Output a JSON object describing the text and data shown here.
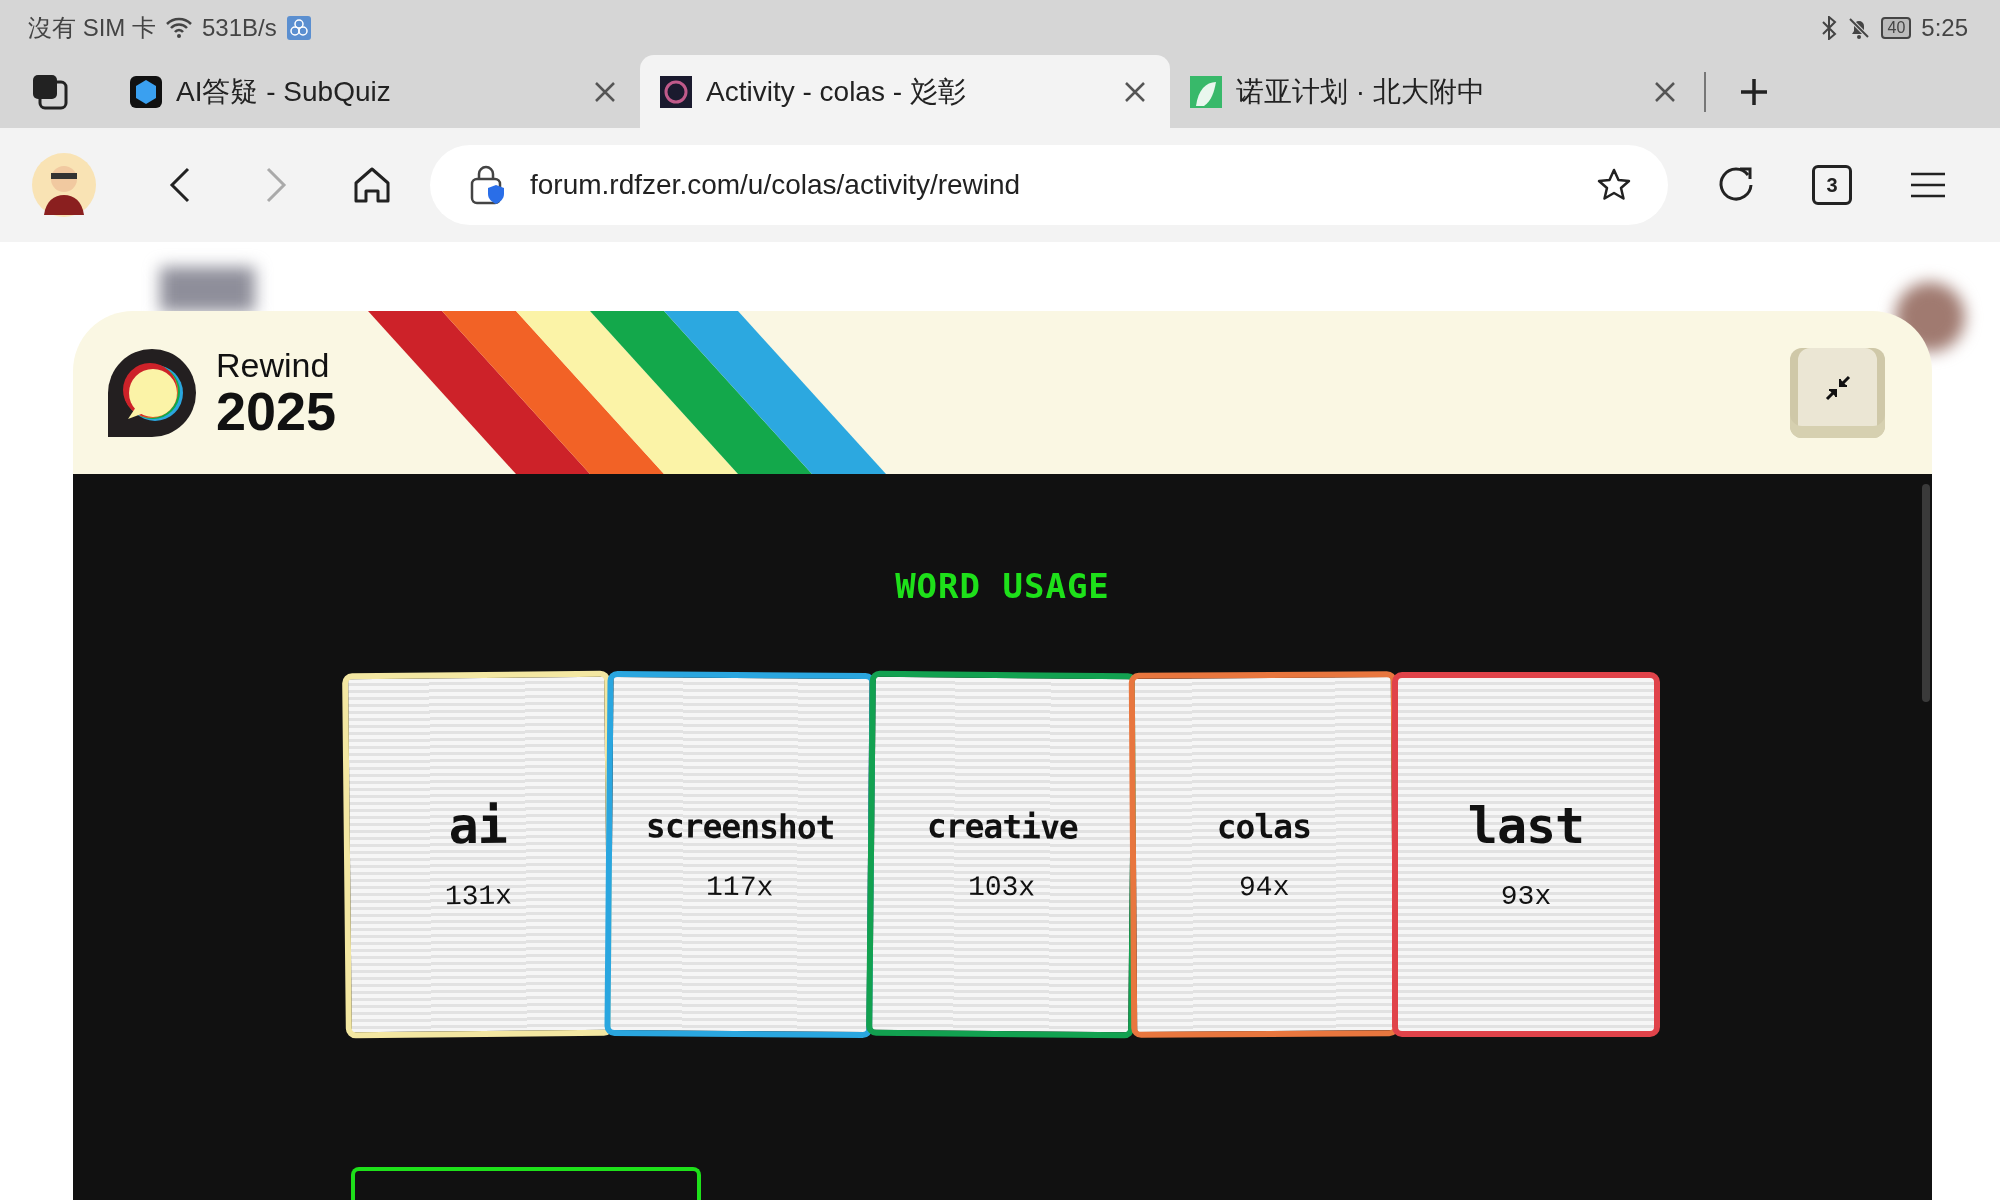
{
  "status_bar": {
    "carrier": "沒有 SIM 卡",
    "speed": "531B/s",
    "battery": "40",
    "time": "5:25"
  },
  "tabs": [
    {
      "title": "AI答疑 - SubQuiz",
      "selected": false
    },
    {
      "title": "Activity - colas - 彣彰",
      "selected": true
    },
    {
      "title": "诺亚计划 · 北大附中",
      "selected": false
    }
  ],
  "toolbar": {
    "url": "forum.rdfzer.com/u/colas/activity/rewind",
    "tab_count": "3"
  },
  "rewind": {
    "label": "Rewind",
    "year": "2025",
    "section_title": "WORD USAGE",
    "words": [
      {
        "word": "ai",
        "count": "131x",
        "color": "#f3e7a2"
      },
      {
        "word": "screenshot",
        "count": "117x",
        "color": "#2aa6df"
      },
      {
        "word": "creative",
        "count": "103x",
        "color": "#12a150"
      },
      {
        "word": "colas",
        "count": "94x",
        "color": "#e8763e"
      },
      {
        "word": "last",
        "count": "93x",
        "color": "#e0434a"
      }
    ]
  }
}
